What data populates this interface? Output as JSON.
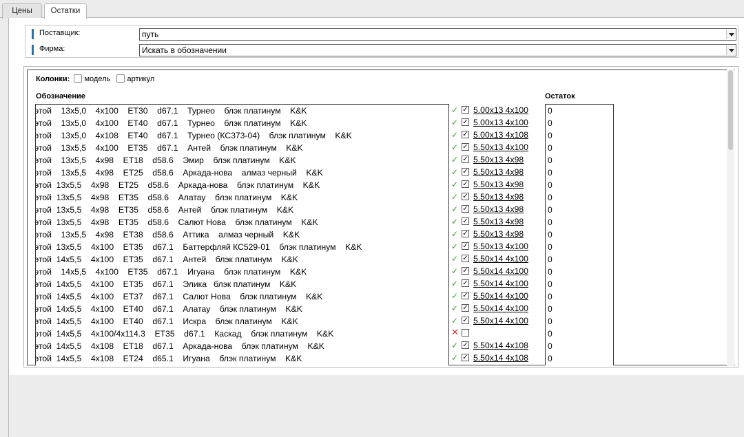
{
  "tabs": [
    {
      "label": "Цены",
      "active": false
    },
    {
      "label": "Остатки",
      "active": true
    }
  ],
  "filters": {
    "supplier_label": "Поставщик:",
    "supplier_value": "путь",
    "firm_label": "Фирма:",
    "firm_value": "Искать в обозначении"
  },
  "columns": {
    "label": "Колонки:",
    "model_label": "модель",
    "article_label": "артикул"
  },
  "headers": {
    "designation": "Обозначение",
    "remain": "Остаток"
  },
  "rows": [
    {
      "text": "этой    13x5,0    4x100    ET30    d67.1    Турнео    блэк платинум    K&K",
      "status": "ok",
      "link": "5.00x13 4x100",
      "remain": "0"
    },
    {
      "text": "этой    13x5,0    4x100    ET40    d67.1    Турнео    блэк платинум    K&K",
      "status": "ok",
      "link": "5.00x13 4x100",
      "remain": "0"
    },
    {
      "text": "этой    13x5,0    4x108    ET40    d67.1    Турнео (КС373-04)    блэк платинум    K&K",
      "status": "ok",
      "link": "5.00x13 4x108",
      "remain": "0"
    },
    {
      "text": "этой    13x5,5    4x100    ET35    d67.1    Антей    блэк платинум    K&K",
      "status": "ok",
      "link": "5.50x13 4x100",
      "remain": "0"
    },
    {
      "text": "этой    13x5,5    4x98    ET18    d58.6    Эмир    блэк платинум    K&K",
      "status": "ok",
      "link": "5.50x13 4x98",
      "remain": "0"
    },
    {
      "text": "этой    13x5,5    4x98    ET25    d58.6    Аркада-нова    алмаз черный    K&K",
      "status": "ok",
      "link": "5.50x13 4x98",
      "remain": "0"
    },
    {
      "text": "этой  13x5,5    4x98    ET25    d58.6    Аркада-нова    блэк платинум    K&K",
      "status": "ok",
      "link": "5.50x13 4x98",
      "remain": "0"
    },
    {
      "text": "этой  13x5,5    4x98    ET35    d58.6    Алатау    блэк платинум    K&K",
      "status": "ok",
      "link": "5.50x13 4x98",
      "remain": "0"
    },
    {
      "text": "этой  13x5,5    4x98    ET35    d58.6    Антей    блэк платинум    K&K",
      "status": "ok",
      "link": "5.50x13 4x98",
      "remain": "0"
    },
    {
      "text": "этой  13x5,5    4x98    ET35    d58.6    Салют Нова    блэк платинум    K&K",
      "status": "ok",
      "link": "5.50x13 4x98",
      "remain": "0"
    },
    {
      "text": "этой    13x5,5    4x98    ET38    d58.6    Аттика    алмаз черный    K&K",
      "status": "ok",
      "link": "5.50x13 4x98",
      "remain": "0"
    },
    {
      "text": "этой  13x5,5    4x100    ET35    d67.1    Баттерфляй КС529-01    блэк платинум    K&K",
      "status": "ok",
      "link": "5.50x13 4x100",
      "remain": "0"
    },
    {
      "text": "этой  14x5,5    4x100    ET35    d67.1    Антей    блэк платинум    K&K",
      "status": "ok",
      "link": "5.50x14 4x100",
      "remain": "0"
    },
    {
      "text": "этой    14x5,5    4x100    ET35    d67.1    Игуана    блэк платинум    K&K",
      "status": "ok",
      "link": "5.50x14 4x100",
      "remain": "0"
    },
    {
      "text": "этой  14x5,5    4x100    ET35    d67.1    Элика   блэк платинум    K&K",
      "status": "ok",
      "link": "5.50x14 4x100",
      "remain": "0"
    },
    {
      "text": "этой  14x5,5    4x100    ET37    d67.1    Салют Нова    блэк платинум    K&K",
      "status": "ok",
      "link": "5.50x14 4x100",
      "remain": "0"
    },
    {
      "text": "этой  14x5,5    4x100    ET40    d67.1    Алатау    блэк платинум    K&K",
      "status": "ok",
      "link": "5.50x14 4x100",
      "remain": "0"
    },
    {
      "text": "этой  14x5,5    4x100    ET40    d67.1    Искра    блэк платинум    K&K",
      "status": "ok",
      "link": "5.50x14 4x100",
      "remain": "0"
    },
    {
      "text": "этой  14x5,5    4x100/4x114.3    ET35    d67.1    Каскад    блэк платинум    K&K",
      "status": "bad",
      "link": "",
      "remain": "0"
    },
    {
      "text": "этой  14x5,5    4x108    ET18    d67.1    Аркада-нова    блэк платинум    K&K",
      "status": "ok",
      "link": "5.50x14 4x108",
      "remain": "0"
    },
    {
      "text": "этой  14x5,5    4x108    ET24    d65.1    Игуана    блэк платинум    K&K",
      "status": "ok",
      "link": "5.50x14 4x108",
      "remain": "0"
    }
  ]
}
